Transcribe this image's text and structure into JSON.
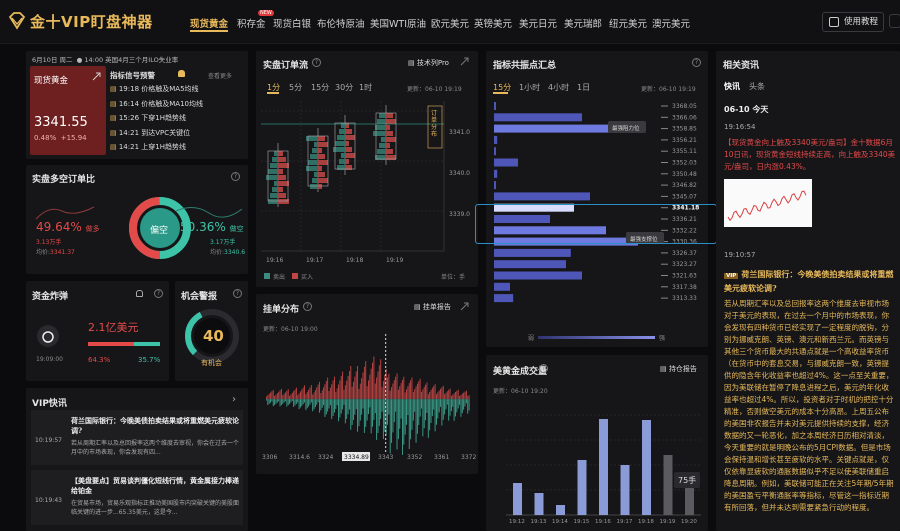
{
  "app": {
    "title": "金十VIP盯盘神器"
  },
  "nav": {
    "items": [
      "现货黄金",
      "积存金",
      "现货白银",
      "布伦特原油",
      "美国WTI原油",
      "欧元美元",
      "英镑美元",
      "美元日元",
      "美元瑞郎",
      "纽元美元",
      "澳元美元"
    ],
    "new_badge": "NEW",
    "tutorial": "使用教程"
  },
  "ticker": {
    "date": "6月10日 周二",
    "time": "14:00",
    "event": "英国4月三个月ILO失业率"
  },
  "price": {
    "name": "现货黄金",
    "value": "3341.55",
    "pct": "0.48%",
    "change": "+15.94"
  },
  "warnings": {
    "title": "指标信号预警",
    "more": "查看更多",
    "items": [
      {
        "time": "19:18",
        "text": "价格触及MA5均线"
      },
      {
        "time": "16:14",
        "text": "价格触及MA10均线"
      },
      {
        "time": "15:26",
        "text": "下穿1H趋势线"
      },
      {
        "time": "14:21",
        "text": "到达VPC关键位"
      },
      {
        "time": "14:21",
        "text": "上穿1H趋势线"
      }
    ]
  },
  "ls": {
    "title": "实盘多空订单比",
    "left_pct": "49.64%",
    "left_lbl": "做多",
    "left_amt": "3.13万手",
    "left_avg_lbl": "均价:",
    "left_avg": "3341.37",
    "center": "偏空",
    "right_pct": "50.36%",
    "right_lbl": "做空",
    "right_amt": "3.17万手",
    "right_avg_lbl": "均价:",
    "right_avg": "3340.6",
    "long_ratio": 0.4964
  },
  "flow": {
    "title": "资金炸弹",
    "time": "19:09:00",
    "amount": "2.1亿美元",
    "red_pct": "64.3%",
    "green_pct": "35.7%",
    "red_ratio": 0.643
  },
  "opp": {
    "title": "机会警报",
    "value": "40",
    "label": "有机会",
    "ratio": 0.4
  },
  "vip": {
    "title": "VIP快讯",
    "items": [
      {
        "time": "10:19:57",
        "title": "荷兰国际银行：今晚美债拍卖结果或将重燃美元疲软论调?",
        "body": "若从周期汇率以及总回报率这两个维度去审视，你会在过去一个月中的市场表现，你会发现有四..."
      },
      {
        "time": "10:19:43",
        "title": "【美盘要点】贸易谈判僵化短线行情，黄金属接力棒递给铂金",
        "body": "在贸易市场，贸易乐观指标正推动美国股市内突破关键的美股面临关键的进一步...65.35美元，这是今..."
      }
    ]
  },
  "orders": {
    "title": "实盘订单流",
    "badge": "技术列Pro",
    "tabs": [
      "1分",
      "5分",
      "15分",
      "30分",
      "1时"
    ],
    "updated": "更新：06-10 19:19",
    "prices": [
      "3341.0",
      "3340.0",
      "3339.0"
    ],
    "times": [
      "19:16",
      "19:17",
      "19:18",
      "19:19"
    ],
    "legend": [
      "卖出",
      "买入"
    ],
    "unit": "单位：手",
    "side_label": "订单分布"
  },
  "dist": {
    "title": "挂单分布",
    "badge": "挂单报告",
    "updated": "更新：06-10 19:00",
    "xticks": [
      "3306",
      "3314.6",
      "3324",
      "3334.89",
      "3343",
      "3352",
      "3361",
      "3372"
    ],
    "current": "3334.89"
  },
  "levels": {
    "title": "指标共振点汇总",
    "tabs": [
      "15分",
      "1小时",
      "4小时",
      "1日"
    ],
    "updated": "更新：06-10 19:19",
    "prices": [
      "3368.05",
      "3366.06",
      "3358.85",
      "3356.21",
      "3355.11",
      "3352.03",
      "3350.48",
      "3346.82",
      "3345.07",
      "3341.18",
      "3336.21",
      "3332.22",
      "3330.36",
      "3326.37",
      "3323.27",
      "3321.63",
      "3317.38",
      "3313.33"
    ],
    "values": [
      0.01,
      0.55,
      0.72,
      0.02,
      0.01,
      0.15,
      0.02,
      0.01,
      0.6,
      0.5,
      0.35,
      0.7,
      0.9,
      0.48,
      0.45,
      0.55,
      0.1,
      0.12
    ],
    "current": "3341.18",
    "tip_resist": "最强阻力位",
    "tip_support": "最强支撑位",
    "weak": "弱",
    "strong": "强"
  },
  "volume": {
    "title": "美黄金成交量",
    "badge": "持仓报告",
    "updated": "更新：06-10 19:20",
    "times": [
      "19:12",
      "19:13",
      "19:14",
      "19:15",
      "19:16",
      "19:17",
      "19:18",
      "19:19",
      "19:20"
    ],
    "values": [
      32,
      22,
      10,
      55,
      96,
      50,
      95,
      60,
      30
    ],
    "note": "75手"
  },
  "info": {
    "title": "相关资讯",
    "tabs": [
      "快讯",
      "头条"
    ],
    "date": "06-10 今天",
    "items": [
      {
        "time": "19:16:54",
        "text": "【现货黄金向上触及3340美元/盎司】金十数据6月10日讯，现货黄金短线持续走高，向上触及3340美元/盎司，日内涨0.43%。"
      },
      {
        "time": "19:10:57",
        "vip": "VIP",
        "title": "荷兰国际银行：今晚美债拍卖结果或将重燃美元疲软论调?",
        "body": "若从周期汇率以及总回报率这两个维度去审视市场对于美元的表现，在过去一个月中的市场表现，你会发现有四种货币已经实现了一定程度的脱钩，分别为挪威克朗、英镑、澳元和新西兰元。而英镑与其他三个货币最大的共通点就是一个高收益率货币（在货币中的套息交易，与挪威克朗一致，英镑提供的隐含年化收益率也超过4%。这一点至关重要，因为美联储在暂停了降息进程之后，美元的年化收益率也超过4%。所以，投资者对于时机的把控十分精准，否则做空美元的成本十分高昂。上周五公布的美国非农报告并未对美元提供持续的支撑，经济数据的又一轮恶化，加之本周经济日历相对清淡，今天重要的就是明晚公布的5月CPI数据。但是市场会保持温和增长甚至疲软的水平。关键点就是，仅仅依靠显疲软的通胀数据似乎不足以使美联储重启降息周期。例如，美联储可能正在关注5年期/5年期的美国盈亏平衡通胀率等指标，尽管这一指标近期有所回落，但并未达到需要紧急行动的程度。"
      }
    ]
  }
}
